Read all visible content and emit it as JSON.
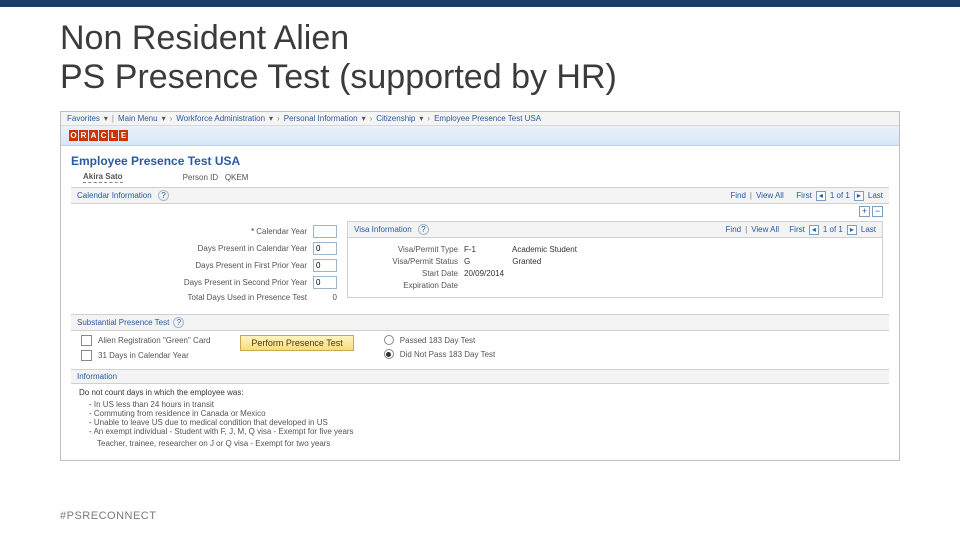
{
  "slide": {
    "title_line1": "Non Resident Alien",
    "title_line2": "PS Presence Test (supported by HR)",
    "hashtag": "#PSRECONNECT"
  },
  "breadcrumbs": {
    "favorites": "Favorites",
    "main_menu": "Main Menu",
    "wf_admin": "Workforce Administration",
    "personal_info": "Personal Information",
    "citizenship": "Citizenship",
    "page": "Employee Presence Test USA"
  },
  "logo_letters": [
    "O",
    "R",
    "A",
    "C",
    "L",
    "E"
  ],
  "page": {
    "title": "Employee Presence Test USA",
    "employee_name": "Akira Sato",
    "person_id_label": "Person ID",
    "person_id_value": "QKEM"
  },
  "cal": {
    "header": "Calendar Information",
    "links": {
      "find": "Find",
      "view_all": "View All",
      "first": "First",
      "last": "Last",
      "pos": "1 of 1"
    },
    "fields": {
      "calendar_year": "Calendar Year",
      "days_cal": "Days Present in Calendar Year",
      "days_first": "Days Present in First Prior Year",
      "days_second": "Days Present in Second Prior Year",
      "total": "Total Days Used in Presence Test"
    },
    "values": {
      "days_cal": "0",
      "days_first": "0",
      "days_second": "0",
      "total": "0"
    }
  },
  "visa": {
    "header": "Visa Information",
    "links": {
      "find": "Find",
      "view All": "View All",
      "first": "First",
      "last": "Last",
      "pos": "1 of 1"
    },
    "fields": {
      "type": "Visa/Permit Type",
      "status": "Visa/Permit Status",
      "start": "Start Date",
      "exp": "Expiration Date"
    },
    "values": {
      "type_code": "F-1",
      "type_desc": "Academic Student",
      "status_code": "G",
      "status_desc": "Granted",
      "start": "20/09/2014",
      "exp": ""
    }
  },
  "sp": {
    "header": "Substantial Presence Test",
    "chk_green": "Alien Registration \"Green\" Card",
    "chk_31": "31 Days in Calendar Year",
    "button": "Perform Presence Test",
    "radio_pass": "Passed 183 Day Test",
    "radio_fail": "Did Not Pass 183 Day Test"
  },
  "info": {
    "header": "Information",
    "lead": "Do not count days in which the employee was:",
    "items": [
      "In US less than 24 hours in transit",
      "Commuting from residence in Canada or Mexico",
      "Unable to leave US due to medical condition that developed in US",
      "An exempt individual - Student with F, J, M, Q visa - Exempt for five years"
    ],
    "footer": "Teacher, trainee, researcher on J or Q visa - Exempt for two years"
  }
}
